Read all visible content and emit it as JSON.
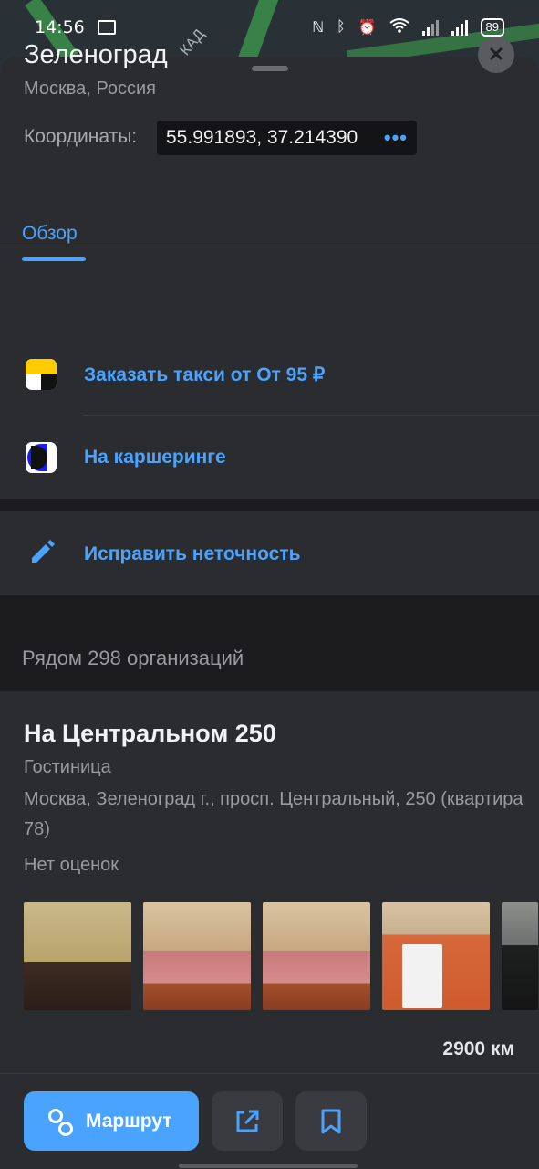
{
  "status_bar": {
    "time": "14:56",
    "battery": "89",
    "icons": [
      "cast-icon",
      "nfc-icon",
      "bluetooth-icon",
      "alarm-icon",
      "wifi-icon",
      "signal-icon",
      "signal-icon",
      "battery-icon"
    ]
  },
  "map": {
    "road_label": "КАД"
  },
  "place": {
    "title": "Зеленоград",
    "subtitle": "Москва, Россия",
    "coords_label": "Координаты:",
    "coords_value": "55.991893, 37.214390",
    "coords_more": "•••",
    "close_icon": "close-icon"
  },
  "tabs": [
    {
      "label": "Обзор",
      "active": true
    }
  ],
  "actions": {
    "taxi_label": "Заказать такси от От 95 ₽",
    "carsharing_label": "На каршеринге",
    "fix_label": "Исправить неточность"
  },
  "nearby": {
    "title": "Рядом 298 организаций"
  },
  "organization": {
    "name": "На Центральном 250",
    "category": "Гостиница",
    "address": "Москва, Зеленоград г., просп. Центральный, 250 (квартира 78)",
    "rating": "Нет оценок",
    "photos": [
      "dining-room-photo",
      "bedroom-photo",
      "bedroom-photo",
      "bathroom-photo",
      "tv-room-photo"
    ],
    "distance": "2900 км"
  },
  "bottom_bar": {
    "route_label": "Маршрут",
    "share_icon": "share-icon",
    "bookmark_icon": "bookmark-icon"
  },
  "colors": {
    "accent": "#4aa3ff",
    "sheet": "#2b2c30",
    "background": "#1c1c1e"
  }
}
